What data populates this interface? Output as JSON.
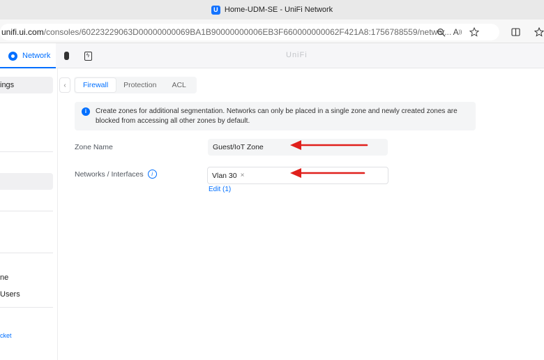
{
  "browser": {
    "tab_title": "Home-UDM-SE - UniFi Network",
    "favicon_letter": "U",
    "url_host": "unifi.ui.com",
    "url_path": "/consoles/60223229063D00000000069BA1B90000000006EB3F660000000062F421A8:1756788559/networ..."
  },
  "app_header": {
    "network_tab_label": "Network",
    "brand_label": "UniFi"
  },
  "sidebar": {
    "items": [
      {
        "label": "ings"
      },
      {
        "label": ""
      },
      {
        "label": "ne"
      },
      {
        "label": "Users"
      }
    ],
    "support_link": "cket"
  },
  "tabs": [
    "Firewall",
    "Protection",
    "ACL"
  ],
  "selected_tab": "Firewall",
  "info_banner": {
    "line1": "Create zones for additional segmentation. Networks can only be placed in a single zone and newly created zones are",
    "line2": "blocked from accessing all other zones by default."
  },
  "form": {
    "zone_name_label": "Zone Name",
    "zone_name_value": "Guest/IoT Zone",
    "networks_label": "Networks / Interfaces",
    "network_chip": "Vlan 30",
    "edit_link": "Edit (1)"
  },
  "colors": {
    "accent": "#006fff",
    "annotation_arrow": "#e0201c"
  }
}
